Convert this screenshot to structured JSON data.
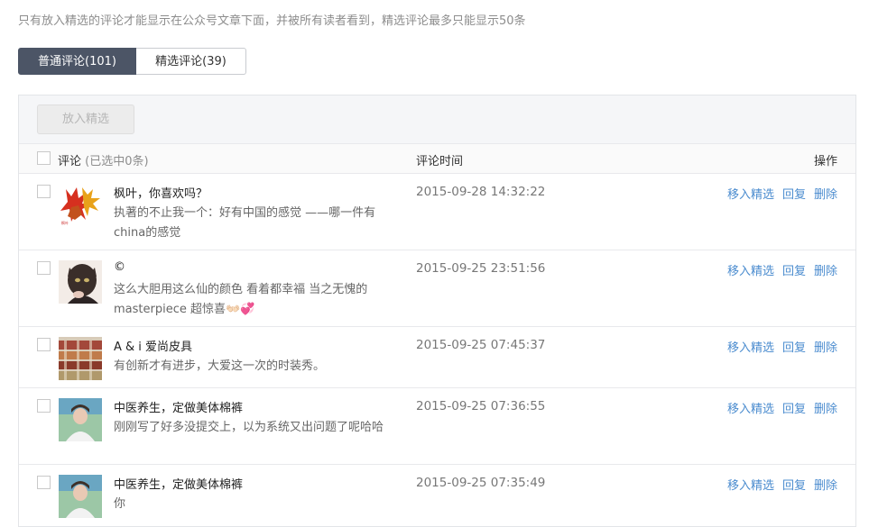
{
  "notice": "只有放入精选的评论才能显示在公众号文章下面，并被所有读者看到，精选评论最多只能显示50条",
  "tabs": {
    "normal": "普通评论(101)",
    "featured": "精选评论(39)"
  },
  "toolbar": {
    "add_featured": "放入精选"
  },
  "table": {
    "col_comment": "评论",
    "col_comment_selected": "(已选中0条)",
    "col_time": "评论时间",
    "col_actions": "操作"
  },
  "actions": {
    "move": "移入精选",
    "reply": "回复",
    "delete": "删除"
  },
  "rows": [
    {
      "nick": "枫叶，你喜欢吗？",
      "content": "执著的不止我一个：好有中国的感觉 ——哪一件有china的感觉",
      "time": "2015-09-28 14:32:22",
      "avatar": "maple-leaves"
    },
    {
      "nick": "©",
      "content": "这么大胆用这么仙的颜色 看着都幸福 当之无愧的masterpiece 超惊喜👐🏻💞",
      "time": "2015-09-25 23:51:56",
      "avatar": "cat-girl"
    },
    {
      "nick": "A & i 爱尚皮具",
      "content": "有创新才有进步，大爱这一次的时装秀。",
      "time": "2015-09-25 07:45:37",
      "avatar": "leather-shop"
    },
    {
      "nick": "中医养生，定做美体棉裤",
      "content": "刚刚写了好多没提交上，以为系统又出问题了呢哈哈",
      "time": "2015-09-25 07:36:55",
      "avatar": "woman-portrait"
    },
    {
      "nick": "中医养生，定做美体棉裤",
      "content": "你",
      "time": "2015-09-25 07:35:49",
      "avatar": "woman-portrait"
    }
  ]
}
